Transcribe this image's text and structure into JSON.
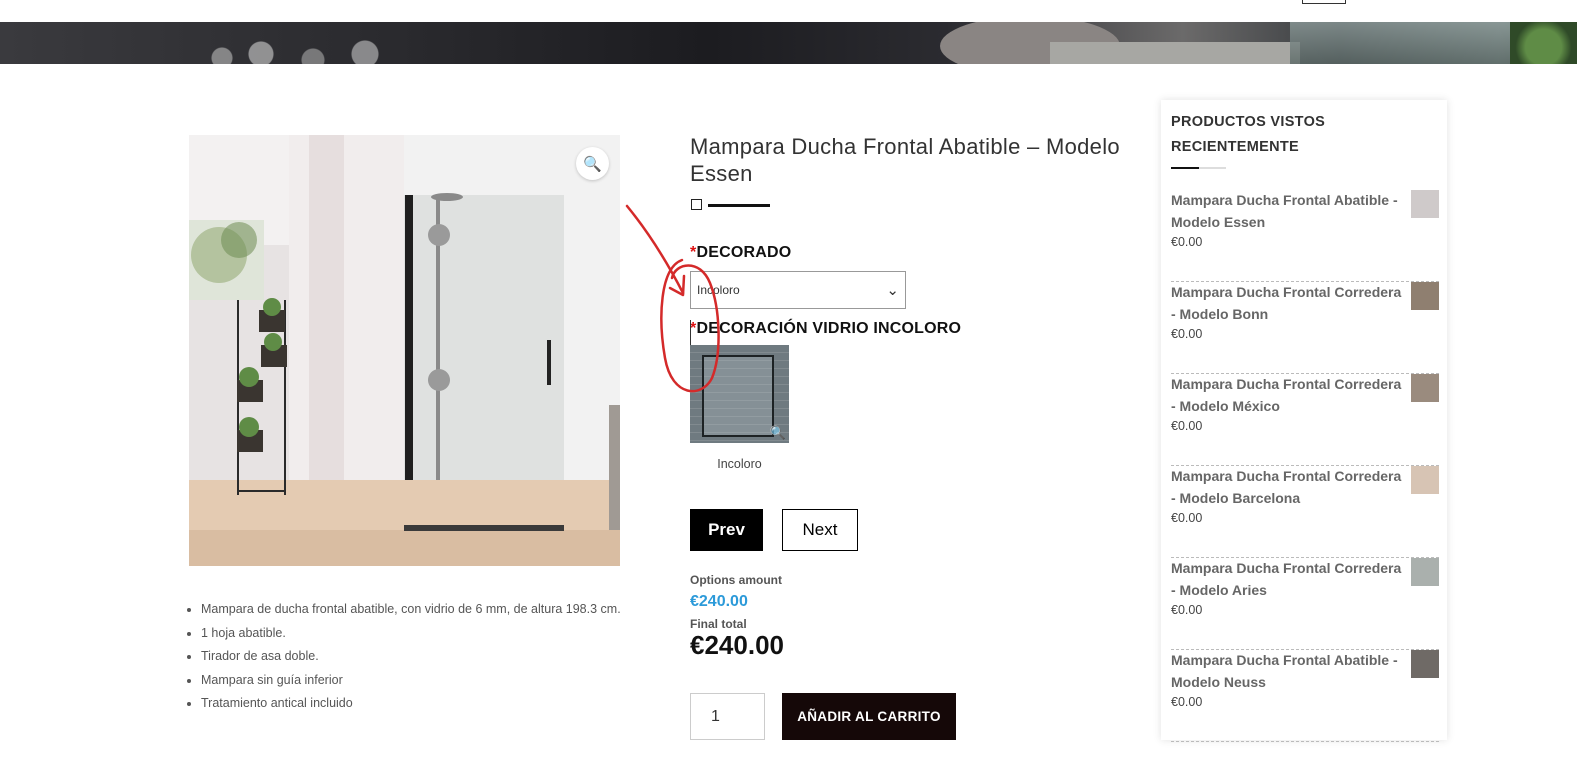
{
  "product": {
    "title": "Mampara Ducha Frontal Abatible – Modelo Essen",
    "features": [
      "Mampara de ducha frontal abatible, con vidrio de 6 mm, de altura 198.3 cm.",
      "1 hoja abatible.",
      "Tirador de asa doble.",
      "Mampara sin guía inferior",
      "Tratamiento antical incluido"
    ]
  },
  "options": {
    "required_mark": "*",
    "decorado_label": "DECORADO",
    "decorado_value": "Incoloro",
    "vidrio_label": "DECORACIÓN VIDRIO INCOLORO",
    "swatch_label": "Incoloro"
  },
  "nav": {
    "prev": "Prev",
    "next": "Next"
  },
  "totals": {
    "options_amount_label": "Options amount",
    "options_amount": "€240.00",
    "final_total_label": "Final total",
    "final_total": "€240.00"
  },
  "cart": {
    "quantity": "1",
    "add_button": "AÑADIR AL CARRITO"
  },
  "sidebar": {
    "title": "PRODUCTOS VISTOS RECIENTEMENTE",
    "items": [
      {
        "name": "Mampara Ducha Frontal Abatible - Modelo Essen",
        "price": "€0.00"
      },
      {
        "name": "Mampara Ducha Frontal Corredera - Modelo Bonn",
        "price": "€0.00"
      },
      {
        "name": "Mampara Ducha Frontal Corredera - Modelo México",
        "price": "€0.00"
      },
      {
        "name": "Mampara Ducha Frontal Corredera - Modelo Barcelona",
        "price": "€0.00"
      },
      {
        "name": "Mampara Ducha Frontal Corredera - Modelo Aries",
        "price": "€0.00"
      },
      {
        "name": "Mampara Ducha Frontal Abatible - Modelo Neuss",
        "price": "€0.00"
      }
    ]
  },
  "icons": {
    "zoom": "magnifier-icon",
    "select_chevron": "chevron-down-icon"
  },
  "colors": {
    "price_blue": "#2c9ad9",
    "required_red": "#d11111",
    "annotation_red": "#d42a2a",
    "cart_button": "#150808"
  }
}
